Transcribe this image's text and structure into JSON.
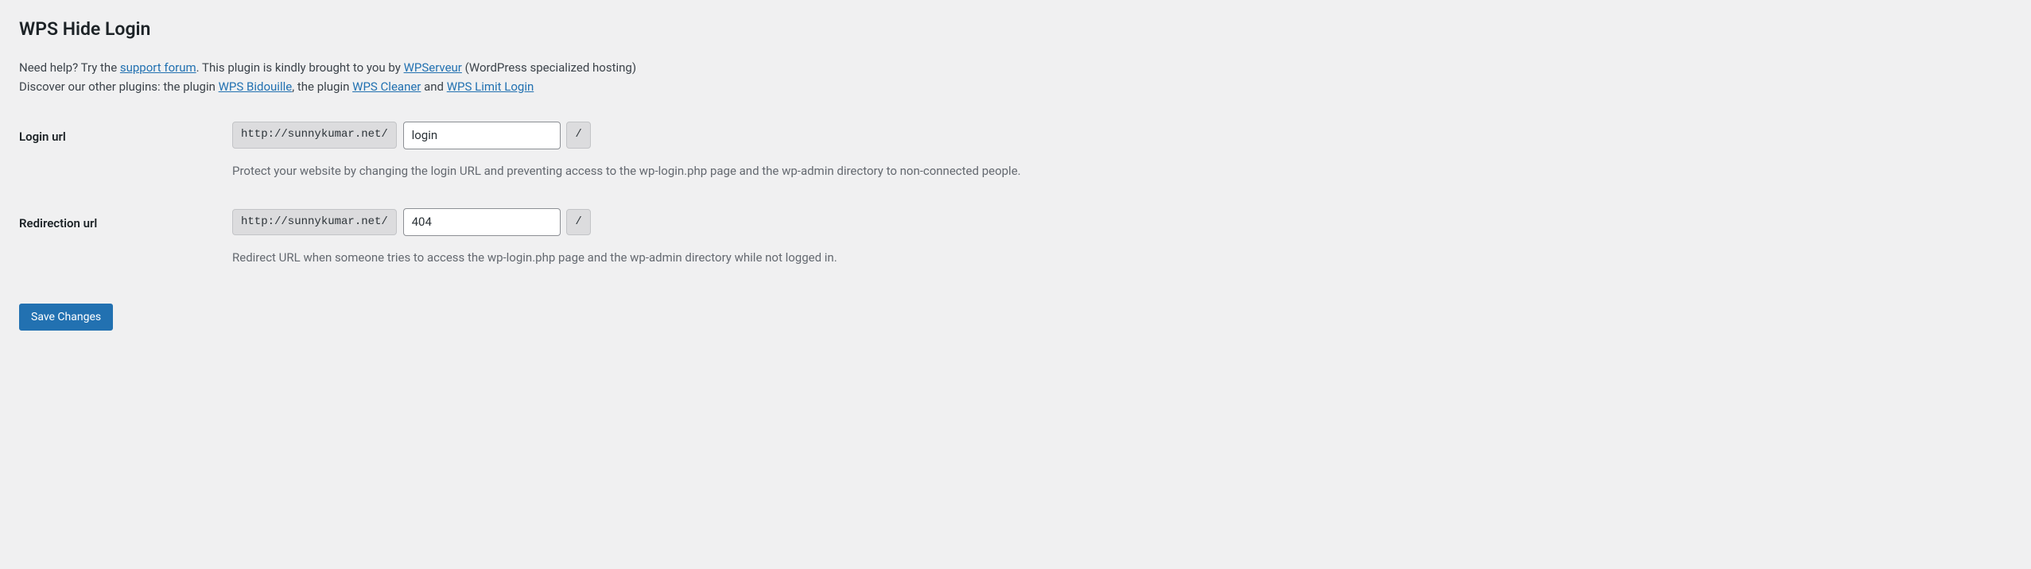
{
  "heading": "WPS Hide Login",
  "intro": {
    "line1_prefix": "Need help? Try the ",
    "support_forum": "support forum",
    "line1_mid": ". This plugin is kindly brought to you by ",
    "wpserveur": "WPServeur",
    "line1_suffix": " (WordPress specialized hosting)",
    "line2_prefix": "Discover our other plugins: the plugin ",
    "wps_bidouille": "WPS Bidouille",
    "line2_mid1": ", the plugin ",
    "wps_cleaner": "WPS Cleaner",
    "line2_mid2": " and ",
    "wps_limit_login": "WPS Limit Login"
  },
  "fields": {
    "login_url": {
      "label": "Login url",
      "prefix": "http://sunnykumar.net/",
      "value": "login",
      "suffix": "/",
      "description": "Protect your website by changing the login URL and preventing access to the wp-login.php page and the wp-admin directory to non-connected people."
    },
    "redirect_url": {
      "label": "Redirection url",
      "prefix": "http://sunnykumar.net/",
      "value": "404",
      "suffix": "/",
      "description": "Redirect URL when someone tries to access the wp-login.php page and the wp-admin directory while not logged in."
    }
  },
  "submit_label": "Save Changes"
}
